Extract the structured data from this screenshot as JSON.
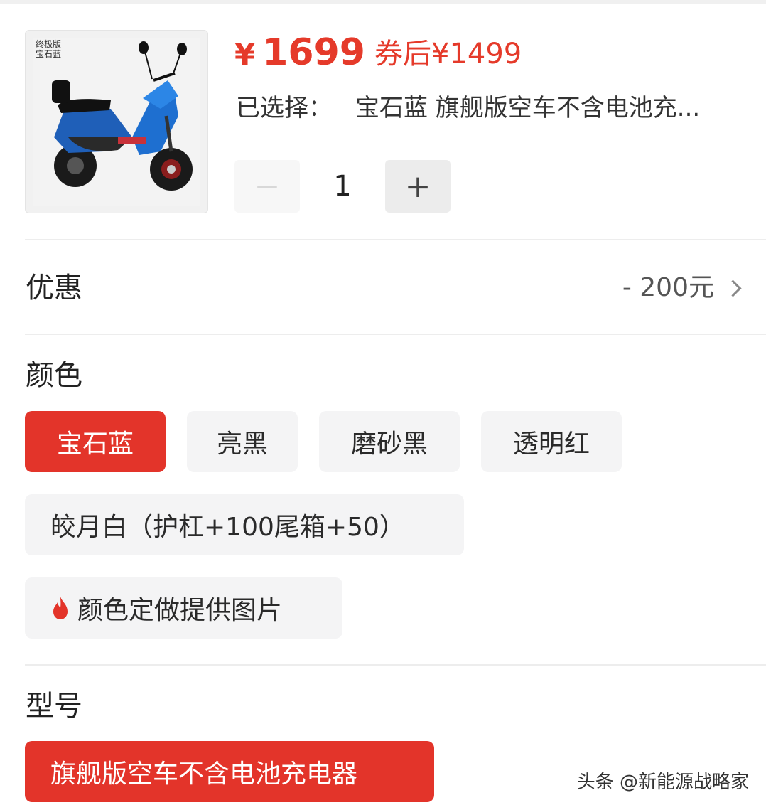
{
  "product": {
    "image_tag_line1": "终极版",
    "image_tag_line2": "宝石蓝",
    "price_symbol": "¥",
    "price": "1699",
    "coupon_price": "券后¥1499",
    "selected_label": "已选择：",
    "selected_value": "宝石蓝 旗舰版空车不含电池充..."
  },
  "quantity": {
    "minus": "−",
    "value": "1",
    "plus": "+"
  },
  "discount": {
    "label": "优惠",
    "value": "- 200元"
  },
  "color": {
    "title": "颜色",
    "options": [
      "宝石蓝",
      "亮黑",
      "磨砂黑",
      "透明红",
      "皎月白（护杠+100尾箱+50）",
      "颜色定做提供图片"
    ],
    "selected": "宝石蓝"
  },
  "model": {
    "title": "型号",
    "options": [
      "旗舰版空车不含电池充电器"
    ],
    "selected": "旗舰版空车不含电池充电器"
  },
  "watermark": "头条 @新能源战略家",
  "colors": {
    "accent": "#e3342a",
    "chip_bg": "#f4f4f5"
  },
  "icons": {
    "flame": "flame-icon",
    "chevron": "chevron-right-icon"
  }
}
